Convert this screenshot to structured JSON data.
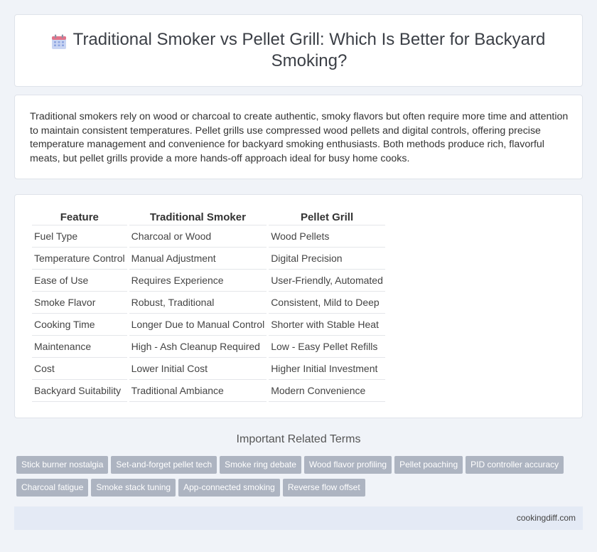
{
  "header": {
    "title": "Traditional Smoker vs Pellet Grill: Which Is Better for Backyard Smoking?",
    "icon": "calendar-icon"
  },
  "intro": {
    "text": "Traditional smokers rely on wood or charcoal to create authentic, smoky flavors but often require more time and attention to maintain consistent temperatures. Pellet grills use compressed wood pellets and digital controls, offering precise temperature management and convenience for backyard smoking enthusiasts. Both methods produce rich, flavorful meats, but pellet grills provide a more hands-off approach ideal for busy home cooks."
  },
  "table": {
    "headers": [
      "Feature",
      "Traditional Smoker",
      "Pellet Grill"
    ],
    "rows": [
      [
        "Fuel Type",
        "Charcoal or Wood",
        "Wood Pellets"
      ],
      [
        "Temperature Control",
        "Manual Adjustment",
        "Digital Precision"
      ],
      [
        "Ease of Use",
        "Requires Experience",
        "User-Friendly, Automated"
      ],
      [
        "Smoke Flavor",
        "Robust, Traditional",
        "Consistent, Mild to Deep"
      ],
      [
        "Cooking Time",
        "Longer Due to Manual Control",
        "Shorter with Stable Heat"
      ],
      [
        "Maintenance",
        "High - Ash Cleanup Required",
        "Low - Easy Pellet Refills"
      ],
      [
        "Cost",
        "Lower Initial Cost",
        "Higher Initial Investment"
      ],
      [
        "Backyard Suitability",
        "Traditional Ambiance",
        "Modern Convenience"
      ]
    ]
  },
  "related": {
    "title": "Important Related Terms",
    "tags": [
      "Stick burner nostalgia",
      "Set-and-forget pellet tech",
      "Smoke ring debate",
      "Wood flavor profiling",
      "Pellet poaching",
      "PID controller accuracy",
      "Charcoal fatigue",
      "Smoke stack tuning",
      "App-connected smoking",
      "Reverse flow offset"
    ]
  },
  "footer": {
    "site": "cookingdiff.com"
  },
  "colors": {
    "background": "#f0f3f8",
    "tag": "#adb4c1",
    "footer": "#e4eaf5",
    "icon_top": "#e2748a",
    "icon_body": "#8ea5e0"
  }
}
